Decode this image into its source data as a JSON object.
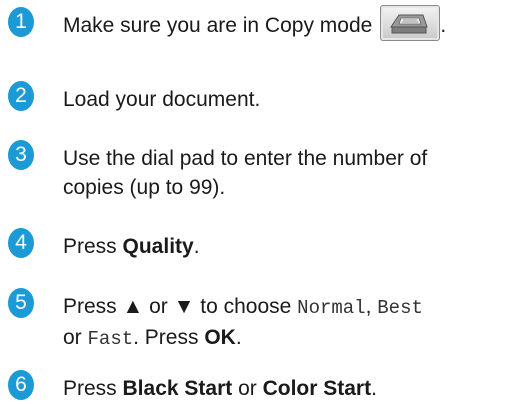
{
  "steps": [
    {
      "number": "1",
      "text": "Make sure you are in Copy mode",
      "icon": "copy-mode-button-icon",
      "trailing": "."
    },
    {
      "number": "2",
      "text": "Load your document."
    },
    {
      "number": "3",
      "line1": "Use the dial pad to enter the number of",
      "line2": "copies (up to 99)."
    },
    {
      "number": "4",
      "pre": "Press ",
      "bold": "Quality",
      "post": "."
    },
    {
      "number": "5",
      "pre": "Press ▲ or ▼ to choose ",
      "opt1": "Normal",
      "sep1": ", ",
      "opt2": "Best",
      "line2_pre": "or ",
      "opt3": "Fast",
      "line2_mid": ". Press ",
      "bold": "OK",
      "line2_post": "."
    },
    {
      "number": "6",
      "pre": "Press ",
      "bold1": "Black Start",
      "mid": " or ",
      "bold2": "Color Start",
      "post": "."
    }
  ],
  "colors": {
    "badge": "#1b9ad6",
    "text": "#1a1a1a"
  }
}
